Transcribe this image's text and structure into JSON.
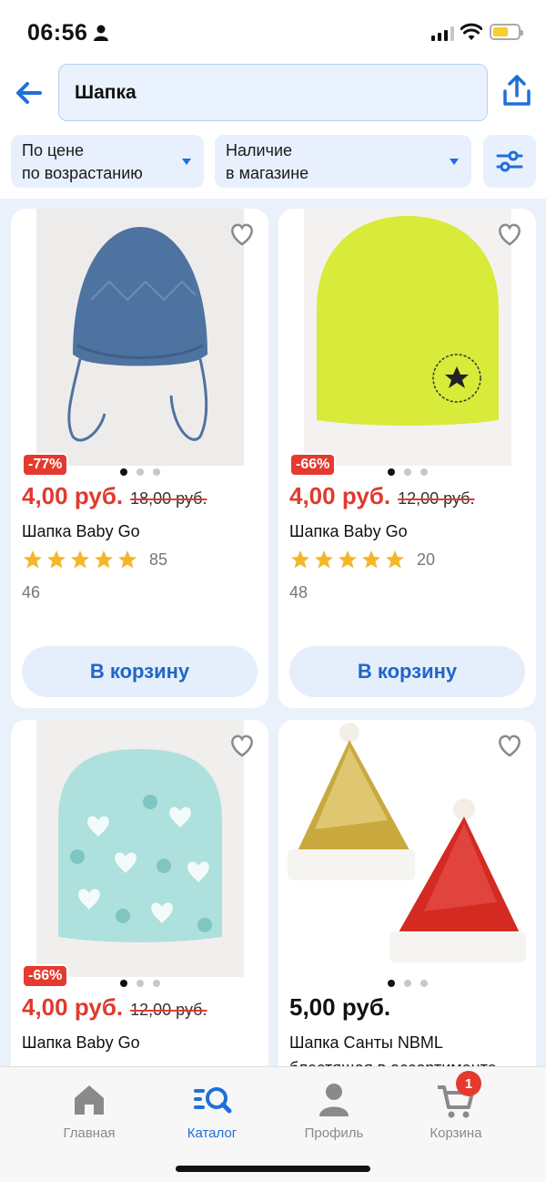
{
  "status": {
    "time": "06:56"
  },
  "search": {
    "query": "Шапка"
  },
  "filters": {
    "sort_line1": "По цене",
    "sort_line2": "по возрастанию",
    "availability_line1": "Наличие",
    "availability_line2": "в магазине"
  },
  "products": [
    {
      "discount": "-77%",
      "price": "4,00 руб.",
      "old_price": "18,00 руб.",
      "name": "Шапка Baby Go",
      "rating": 5,
      "reviews": "85",
      "sizes": "46",
      "button": "В корзину"
    },
    {
      "discount": "-66%",
      "price": "4,00 руб.",
      "old_price": "12,00 руб.",
      "name": "Шапка Baby Go",
      "rating": 5,
      "reviews": "20",
      "sizes": "48",
      "button": "В корзину"
    },
    {
      "discount": "-66%",
      "price": "4,00 руб.",
      "old_price": "12,00 руб.",
      "name": "Шапка Baby Go"
    },
    {
      "price": "5,00 руб.",
      "name": "Шапка Санты NBML",
      "name_line2": "блестящая в ассортименте"
    }
  ],
  "nav": {
    "home": "Главная",
    "catalog": "Каталог",
    "profile": "Профиль",
    "cart": "Корзина",
    "cart_count": "1"
  },
  "colors": {
    "accent": "#1f6fd8",
    "sale": "#e53a2f",
    "star": "#f5b72a"
  }
}
